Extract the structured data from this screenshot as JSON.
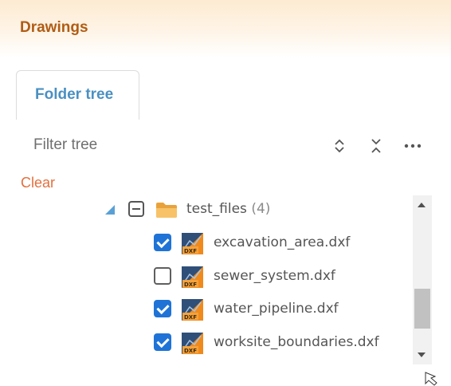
{
  "header": {
    "title": "Drawings"
  },
  "tabs": [
    {
      "label": "Folder tree"
    }
  ],
  "filter": {
    "placeholder": "Filter tree",
    "value": ""
  },
  "toolbar": {
    "icons": [
      "expand-all-icon",
      "collapse-all-icon",
      "more-options-icon"
    ]
  },
  "clear_label": "Clear",
  "tree": {
    "folder": {
      "name": "test_files",
      "count": "(4)",
      "expanded": true,
      "check_state": "indeterminate"
    },
    "files": [
      {
        "name": "excavation_area.dxf",
        "checked": true
      },
      {
        "name": "sewer_system.dxf",
        "checked": false
      },
      {
        "name": "water_pipeline.dxf",
        "checked": true
      },
      {
        "name": "worksite_boundaries.dxf",
        "checked": true
      }
    ]
  },
  "colors": {
    "header_title": "#b05c14",
    "tab_label": "#4a90c2",
    "clear_link": "#e36f3e",
    "checkbox_checked": "#1f73d6",
    "expander": "#5aa0d6",
    "folder": "#f3b04c"
  }
}
